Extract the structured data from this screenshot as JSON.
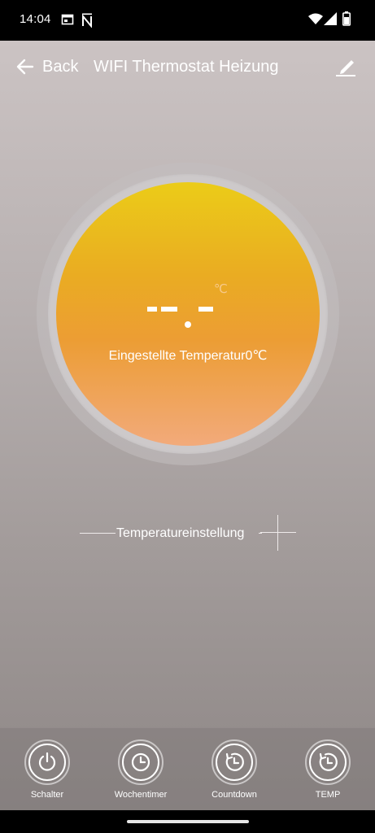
{
  "status_bar": {
    "time": "14:04",
    "icons": [
      "calendar-icon",
      "notification-n-icon",
      "wifi-icon",
      "signal-icon",
      "battery-icon"
    ]
  },
  "header": {
    "back_label": "Back",
    "title": "WIFI Thermostat Heizung",
    "edit_icon": "edit-pencil-icon"
  },
  "dial": {
    "unit": "℃",
    "current_temp_display": "--.-",
    "set_temp_label": "Eingestellte Temperatur0℃",
    "colors": {
      "top": "#ebcc18",
      "middle": "#eaac22",
      "bottom": "#f2aa7b"
    }
  },
  "temperature_setting": {
    "label": "Temperatureinstellung",
    "increase_icon": "plus-icon"
  },
  "bottom_tabs": [
    {
      "label": "Schalter",
      "icon": "power-icon"
    },
    {
      "label": "Wochentimer",
      "icon": "clock-icon"
    },
    {
      "label": "Countdown",
      "icon": "countdown-icon"
    },
    {
      "label": "TEMP",
      "icon": "countdown-icon"
    }
  ]
}
